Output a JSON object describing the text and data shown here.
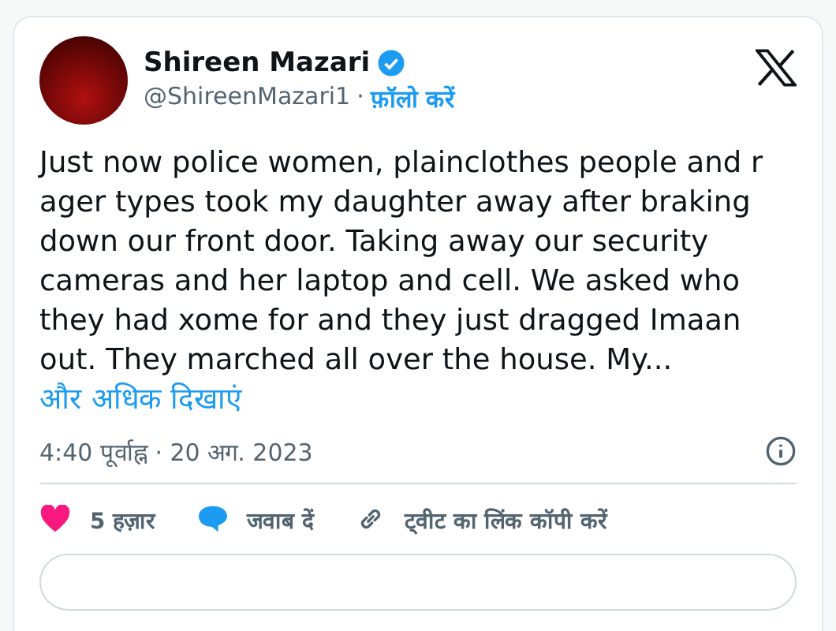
{
  "author": {
    "name": "Shireen Mazari",
    "verified": true,
    "handle": "@ShireenMazari1",
    "separator": "·",
    "follow": "फ़ॉलो करें"
  },
  "body": {
    "text": "Just now police women, plainclothes people and r ager types took my daughter away after braking down our front door. Taking away our security cameras and her laptop and cell. We asked who they had xome for and they just dragged Imaan out. They marched all over the house. My...",
    "more": "और अधिक दिखाएं"
  },
  "timestamp": "4:40 पूर्वाह्न · 20 अग. 2023",
  "actions": [
    {
      "kind": "like",
      "label": "5 हज़ार"
    },
    {
      "kind": "reply",
      "label": "जवाब दें"
    },
    {
      "kind": "link",
      "label": "ट्वीट का लिंक कॉपी करें"
    }
  ]
}
